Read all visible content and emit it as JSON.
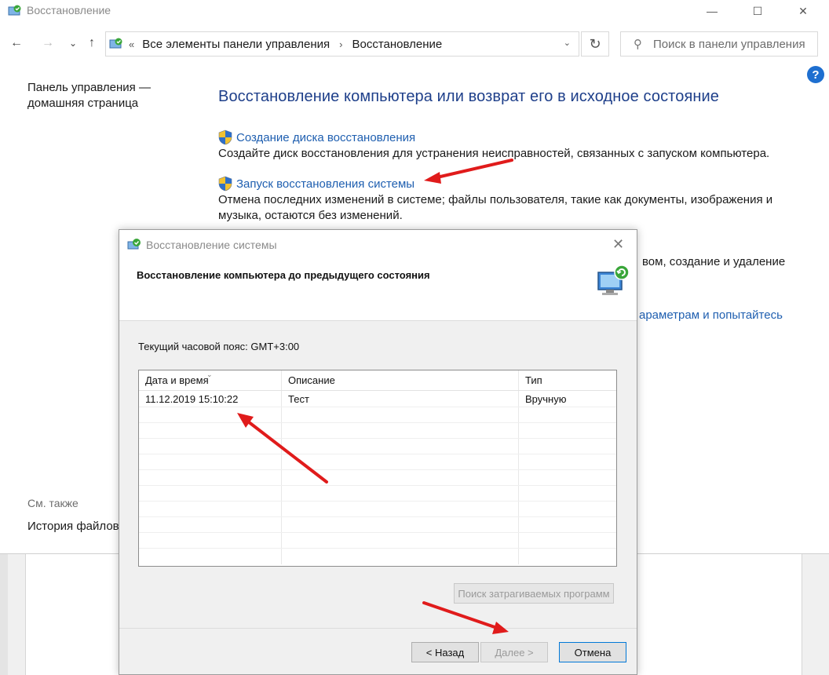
{
  "window": {
    "title": "Восстановление",
    "minimize": "—",
    "maximize": "☐",
    "close": "✕"
  },
  "nav": {
    "back": "←",
    "forward": "→",
    "recent": "⌄",
    "up": "↑",
    "address_sep": "«",
    "breadcrumb": [
      "Все элементы панели управления",
      "Восстановление"
    ],
    "crumb_sep": "›",
    "dropdown": "⌄",
    "refresh": "↻",
    "search_icon": "⚲",
    "search_placeholder": "Поиск в панели управления"
  },
  "help": "?",
  "left_nav": {
    "home_link": "Панель управления — домашняя страница",
    "see_also": "См. также",
    "file_history": "История файлов"
  },
  "main": {
    "heading": "Восстановление компьютера или возврат его в исходное состояние",
    "items": [
      {
        "link": "Создание диска восстановления",
        "desc": "Создайте диск восстановления для устранения неисправностей, связанных с запуском компьютера."
      },
      {
        "link": "Запуск восстановления системы",
        "desc_line1": "Отмена последних изменений в системе; файлы пользователя, такие как документы, изображения и",
        "desc_line2": "музыка, остаются без изменений."
      }
    ],
    "partial_text_1": "вом, создание и удаление",
    "partial_link_2": "араметрам и попытайтесь"
  },
  "dialog": {
    "title": "Восстановление системы",
    "close": "✕",
    "subtitle": "Восстановление компьютера до предыдущего состояния",
    "timezone": "Текущий часовой пояс: GMT+3:00",
    "columns": [
      "Дата и время",
      "Описание",
      "Тип"
    ],
    "sort_indicator": "⌄",
    "rows": [
      {
        "date": "11.12.2019 15:10:22",
        "description": "Тест",
        "type": "Вручную"
      }
    ],
    "buttons": {
      "find_affected": "Поиск затрагиваемых программ",
      "back": "< Назад",
      "next": "Далее >",
      "cancel": "Отмена"
    }
  },
  "colors": {
    "heading": "#1e3f8a",
    "link": "#1f5fb0",
    "annotation_arrow": "#e01b1b",
    "help_icon": "#1e6fd0"
  }
}
